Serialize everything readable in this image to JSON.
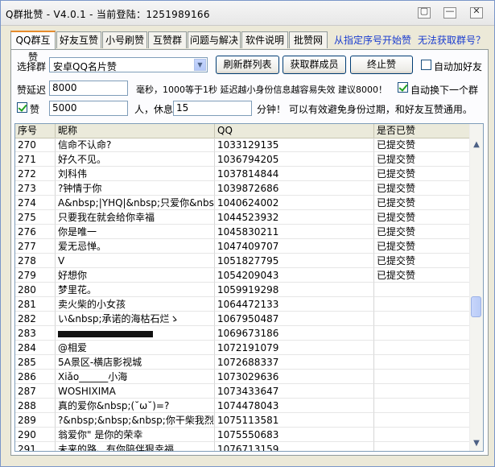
{
  "window": {
    "title": "Q群批赞 - V4.0.1 - 当前登陆：1251989166",
    "buttons": [
      "▢",
      "—",
      "✕"
    ]
  },
  "tabs": [
    {
      "label": "QQ群互赞",
      "active": true
    },
    {
      "label": "好友互赞",
      "active": false
    },
    {
      "label": "小号刷赞",
      "active": false
    },
    {
      "label": "互赞群",
      "active": false
    },
    {
      "label": "问题与解决",
      "active": false
    },
    {
      "label": "软件说明",
      "active": false
    },
    {
      "label": "批赞网",
      "active": false
    }
  ],
  "header_links": {
    "start_from_index": "从指定序号开始赞",
    "cannot_get_group": "无法获取群号？"
  },
  "controls": {
    "select_group_label": "选择群",
    "group_selected": "安卓QQ名片赞",
    "refresh_button": "刷新群列表",
    "get_members_button": "获取群成员",
    "stop_button": "终止赞",
    "auto_add_friend_label": "自动加好友",
    "auto_add_friend_checked": false,
    "delay_label": "赞延迟",
    "delay_value": "8000",
    "delay_hint": "毫秒，1000等于1秒  延迟越小身份信息越容易失效  建议8000！",
    "auto_switch_label": "自动换下一个群",
    "auto_switch_checked": true,
    "like_label": "赞",
    "like_checked": true,
    "like_value": "5000",
    "people_rest_label": "人，休息",
    "rest_value": "15",
    "minutes_hint": "分钟！  可以有效避免身份过期，和好友互赞通用。"
  },
  "table": {
    "columns": [
      "序号",
      "昵称",
      "QQ",
      "是否已赞"
    ],
    "rows": [
      {
        "idx": "270",
        "nick": "信命不认命?",
        "qq": "1033129135",
        "status": "已提交赞"
      },
      {
        "idx": "271",
        "nick": "好久不见。",
        "qq": "1036794205",
        "status": "已提交赞"
      },
      {
        "idx": "272",
        "nick": "刘科伟",
        "qq": "1037814844",
        "status": "已提交赞"
      },
      {
        "idx": "273",
        "nick": "?钟情于你",
        "qq": "1039872686",
        "status": "已提交赞"
      },
      {
        "idx": "274",
        "nick": "A&nbsp;|YHQ|&nbsp;只爱你&nbs…",
        "qq": "1040624002",
        "status": "已提交赞"
      },
      {
        "idx": "275",
        "nick": "只要我在就会给你幸福",
        "qq": "1044523932",
        "status": "已提交赞"
      },
      {
        "idx": "276",
        "nick": "你是唯一",
        "qq": "1045830211",
        "status": "已提交赞"
      },
      {
        "idx": "277",
        "nick": "爱无忌惮。",
        "qq": "1047409707",
        "status": "已提交赞"
      },
      {
        "idx": "278",
        "nick": "V",
        "qq": "1051827795",
        "status": "已提交赞"
      },
      {
        "idx": "279",
        "nick": "好想你",
        "qq": "1054209043",
        "status": "已提交赞"
      },
      {
        "idx": "280",
        "nick": "梦里花。",
        "qq": "1059919298",
        "status": ""
      },
      {
        "idx": "281",
        "nick": "卖火柴的小女孩",
        "qq": "1064472133",
        "status": ""
      },
      {
        "idx": "282",
        "nick": "い&nbsp;承诺的海枯石烂ゝ",
        "qq": "1067950487",
        "status": ""
      },
      {
        "idx": "283",
        "nick": "",
        "qq": "1069673186",
        "status": "",
        "redacted": true
      },
      {
        "idx": "284",
        "nick": "@相爱",
        "qq": "1072191079",
        "status": ""
      },
      {
        "idx": "285",
        "nick": "5A景区-横店影视城",
        "qq": "1072688337",
        "status": ""
      },
      {
        "idx": "286",
        "nick": "Xiǎo______小海",
        "qq": "1073029636",
        "status": ""
      },
      {
        "idx": "287",
        "nick": "WOSHIXIMA",
        "qq": "1073433647",
        "status": ""
      },
      {
        "idx": "288",
        "nick": "真的爱你&nbsp;(˘ω˘)=?",
        "qq": "1074478043",
        "status": ""
      },
      {
        "idx": "289",
        "nick": "?&nbsp;&nbsp;&nbsp;你干柴我烈火@",
        "qq": "1075113581",
        "status": ""
      },
      {
        "idx": "290",
        "nick": "翁爱你\" 是你的荣幸",
        "qq": "1075550683",
        "status": ""
      },
      {
        "idx": "291",
        "nick": "未来的路、有你陪伴狠幸福",
        "qq": "1076713159",
        "status": ""
      }
    ]
  },
  "icons": {
    "scroll_up": "▲",
    "scroll_down": "▼",
    "combo_arrow": "▼"
  }
}
